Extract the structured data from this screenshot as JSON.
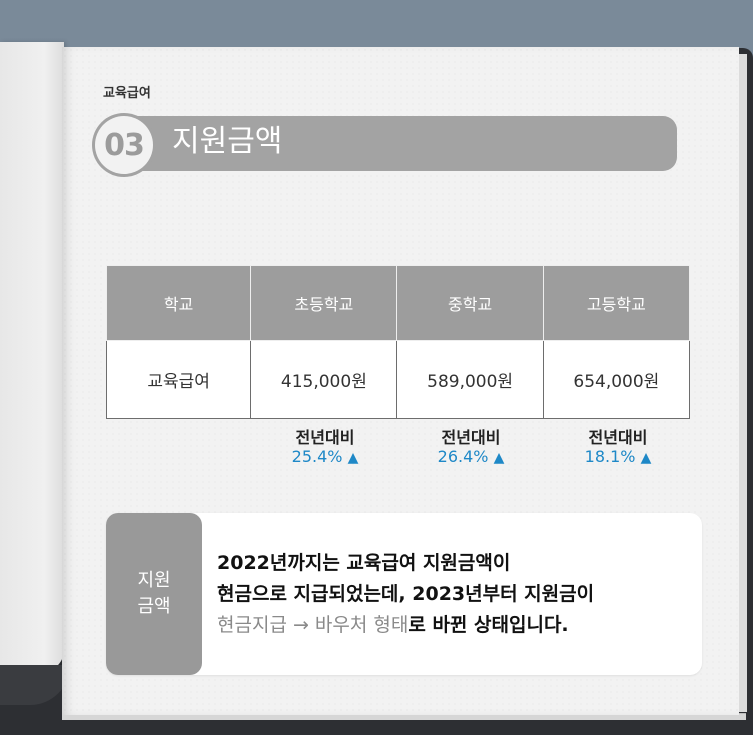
{
  "category": "교육급여",
  "section": {
    "number": "03",
    "title": "지원금액"
  },
  "table": {
    "headers": [
      "학교",
      "초등학교",
      "중학교",
      "고등학교"
    ],
    "row": [
      "교육급여",
      "415,000원",
      "589,000원",
      "654,000원"
    ]
  },
  "yoy": {
    "label": "전년대비",
    "items": [
      {
        "value": "25.4%",
        "arrow": "▲"
      },
      {
        "value": "26.4%",
        "arrow": "▲"
      },
      {
        "value": "18.1%",
        "arrow": "▲"
      }
    ]
  },
  "info": {
    "label_line1": "지원",
    "label_line2": "금액",
    "line1": "2022년까지는 교육급여 지원금액이",
    "line2": "현금으로 지급되었는데, 2023년부터 지원금이",
    "line3_muted": "현금지급 → 바우처 형태",
    "line3_rest": "로 바뀐 상태입니다."
  },
  "colors": {
    "accent_blue": "#1e88c7",
    "header_gray": "#9d9d9d",
    "title_bar_gray": "#a3a3a3"
  }
}
